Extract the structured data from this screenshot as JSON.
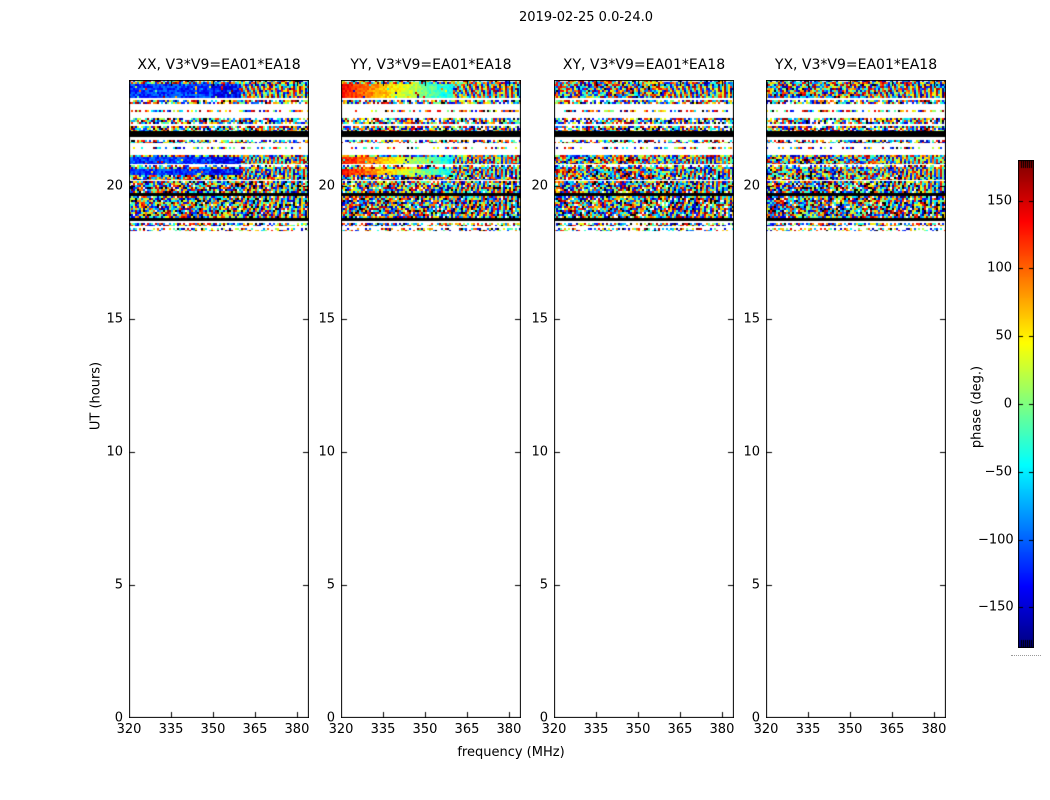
{
  "figure": {
    "title": "2019-02-25 0.0-24.0"
  },
  "panels": [
    {
      "label": "XX, V3*V9=EA01*EA18",
      "pol": "XX",
      "smooth_style": "blue"
    },
    {
      "label": "YY, V3*V9=EA01*EA18",
      "pol": "YY",
      "smooth_style": "warm"
    },
    {
      "label": "XY, V3*V9=EA01*EA18",
      "pol": "XY",
      "smooth_style": "noise"
    },
    {
      "label": "YX, V3*V9=EA01*EA18",
      "pol": "YX",
      "smooth_style": "noise"
    }
  ],
  "axes": {
    "xlabel": "frequency (MHz)",
    "ylabel": "UT (hours)",
    "x_ticks": [
      320,
      335,
      350,
      365,
      380
    ],
    "y_ticks": [
      0,
      5,
      10,
      15,
      20
    ],
    "x_range": [
      320,
      384.3
    ],
    "y_range": [
      0,
      24
    ]
  },
  "colorbar": {
    "label": "phase (deg.)",
    "tick_values": [
      150,
      100,
      50,
      0,
      -50,
      -100,
      -150
    ],
    "tick_labels": [
      "150",
      "100",
      "50",
      "0",
      "−50",
      "−100",
      "−150"
    ],
    "range": [
      -180,
      180
    ],
    "colormap": "jet"
  },
  "chart_data": {
    "type": "heatmap",
    "title": "2019-02-25 0.0-24.0",
    "subplots": [
      "XX, V3*V9=EA01*EA18",
      "YY, V3*V9=EA01*EA18",
      "XY, V3*V9=EA01*EA18",
      "YX, V3*V9=EA01*EA18"
    ],
    "xlabel": "frequency (MHz)",
    "ylabel": "UT (hours)",
    "x_range_mhz": [
      320,
      384.3
    ],
    "x_tick_labels": [
      "320",
      "335",
      "350",
      "365",
      "380"
    ],
    "y_range_hours": [
      0,
      24
    ],
    "y_tick_labels": [
      "0",
      "5",
      "10",
      "15",
      "20"
    ],
    "colorbar_label": "phase (deg.)",
    "colorbar_range_deg": [
      -180,
      180
    ],
    "colormap": "jet",
    "data_extent_hours": [
      18.3,
      24.0
    ],
    "panel_notes": {
      "XX": "smooth bands are blue (phase near -100 to -160 deg) over left two thirds of band, noisy phase-wrap moire on right third",
      "YY": "smooth bands grade orange-yellow-green-cyan (phase +150 down to -50 deg) left to right, noisy moire on right third",
      "XY": "fully random speckle phase noise spanning -180..180 deg",
      "YX": "fully random speckle phase noise spanning -180..180 deg"
    },
    "bands": [
      {
        "from": 23.92,
        "to": 24.0,
        "kind": "dots",
        "density": 0.7
      },
      {
        "from": 23.32,
        "to": 23.92,
        "kind": "smooth"
      },
      {
        "from": 23.1,
        "to": 23.25,
        "kind": "dots",
        "density": 0.8
      },
      {
        "from": 22.79,
        "to": 22.87,
        "kind": "dots",
        "density": 0.55
      },
      {
        "from": 22.34,
        "to": 22.57,
        "kind": "speckle",
        "density": 0.8
      },
      {
        "from": 22.08,
        "to": 22.27,
        "kind": "speckle",
        "density": 0.85
      },
      {
        "from": 21.85,
        "to": 22.08,
        "kind": "black"
      },
      {
        "from": 21.63,
        "to": 21.74,
        "kind": "dots",
        "density": 0.7
      },
      {
        "from": 21.4,
        "to": 21.48,
        "kind": "dots",
        "density": 0.4
      },
      {
        "from": 20.84,
        "to": 21.18,
        "kind": "smooth"
      },
      {
        "from": 20.73,
        "to": 20.8,
        "kind": "dots",
        "density": 0.5
      },
      {
        "from": 20.43,
        "to": 20.73,
        "kind": "smooth"
      },
      {
        "from": 20.24,
        "to": 20.43,
        "kind": "speckle",
        "density": 0.95
      },
      {
        "from": 19.75,
        "to": 20.2,
        "kind": "speckle",
        "density": 0.95
      },
      {
        "from": 19.64,
        "to": 19.75,
        "kind": "black"
      },
      {
        "from": 19.19,
        "to": 19.64,
        "kind": "speckle",
        "density": 0.95
      },
      {
        "from": 18.81,
        "to": 19.19,
        "kind": "speckle",
        "density": 0.95
      },
      {
        "from": 18.7,
        "to": 18.81,
        "kind": "black"
      },
      {
        "from": 18.51,
        "to": 18.62,
        "kind": "dots",
        "density": 0.7
      },
      {
        "from": 18.32,
        "to": 18.43,
        "kind": "dots",
        "density": 0.45
      }
    ]
  }
}
